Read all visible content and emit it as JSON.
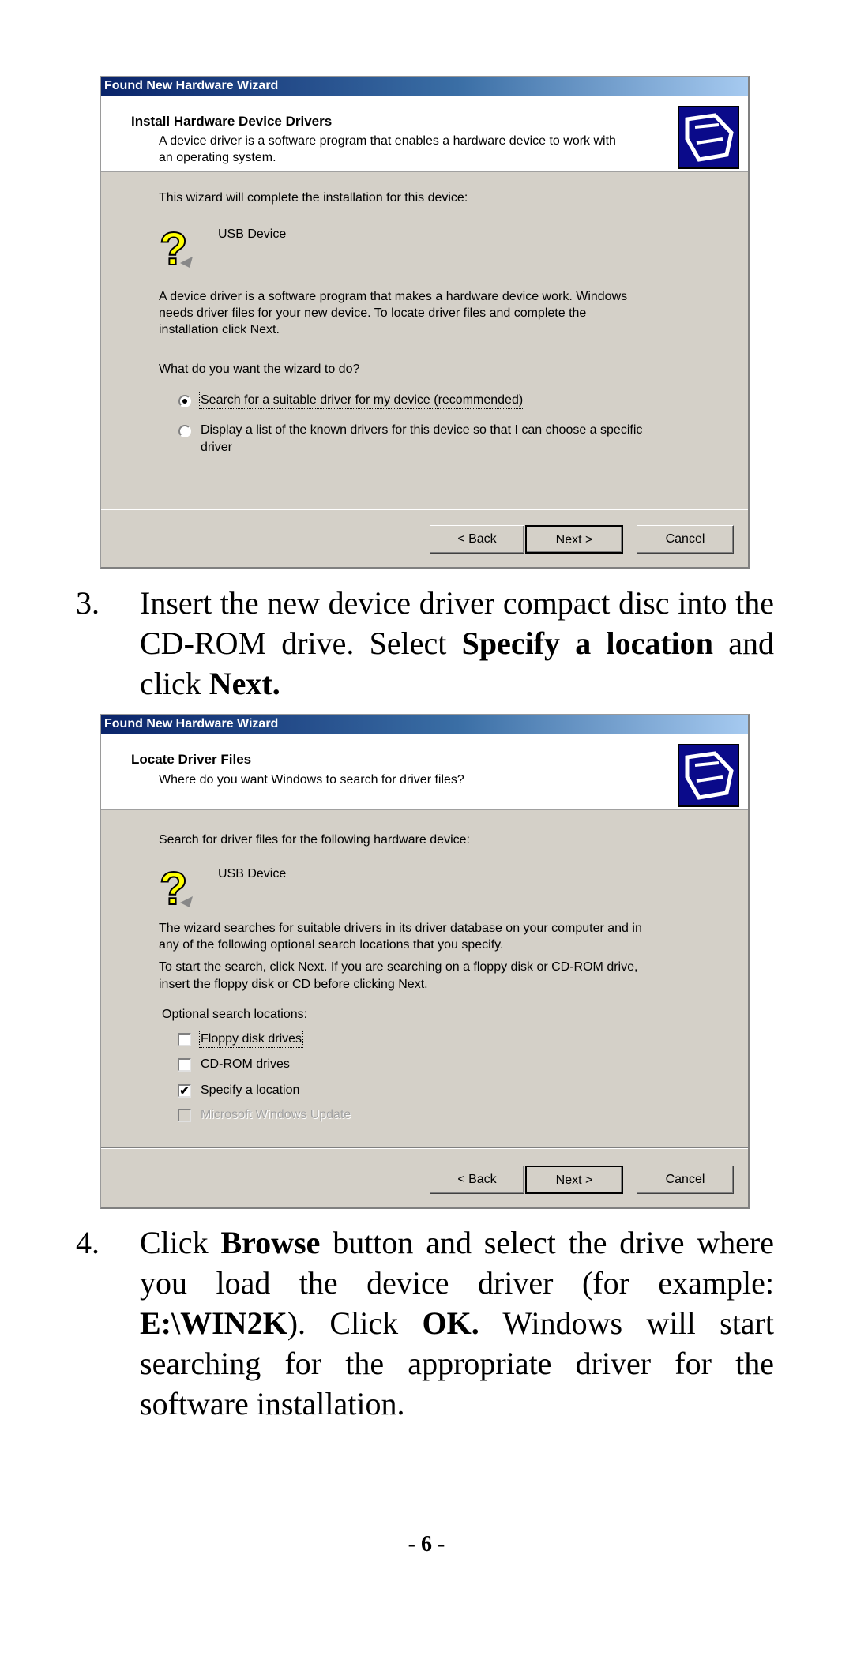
{
  "dialog1": {
    "title": "Found New Hardware Wizard",
    "header_title": "Install Hardware Device Drivers",
    "header_sub": [
      "A device driver is a software program that enables a hardware device to work with",
      "an operating system."
    ],
    "intro": "This wizard will complete the installation for this device:",
    "device": "USB Device",
    "para": [
      "A device driver is a software program that makes a hardware device work. Windows",
      "needs driver files for your new device. To locate driver files and complete the",
      "installation click Next."
    ],
    "question": "What do you want the wizard to do?",
    "option1": "Search for a suitable driver for my device (recommended)",
    "option2": [
      "Display a list of the known drivers for this device so that I can choose a specific",
      "driver"
    ],
    "selected_option": 1,
    "back": "< Back",
    "next": "Next >",
    "cancel": "Cancel"
  },
  "step3": {
    "number": "3.",
    "text_a": "Insert the new device driver compact disc into the CD-ROM drive.  Select ",
    "bold_a": "Specify a location",
    "text_b": " and click ",
    "bold_b": "Next."
  },
  "dialog2": {
    "title": "Found New Hardware Wizard",
    "header_title": "Locate Driver Files",
    "header_sub": "Where do you want Windows to search for driver files?",
    "intro": "Search for driver files for the following hardware device:",
    "device": "USB Device",
    "para1": [
      "The wizard searches for suitable drivers in its driver database on your computer and in",
      "any of the following optional search locations that you specify."
    ],
    "para2": [
      "To start the search, click Next. If you are searching on a floppy disk or CD-ROM drive,",
      "insert the floppy disk or CD before clicking Next."
    ],
    "optional_label": "Optional search locations:",
    "checkboxes": [
      {
        "label": "Floppy disk drives",
        "checked": false,
        "enabled": true
      },
      {
        "label": "CD-ROM drives",
        "checked": false,
        "enabled": true
      },
      {
        "label": "Specify a location",
        "checked": true,
        "enabled": true
      },
      {
        "label": "Microsoft Windows Update",
        "checked": false,
        "enabled": false
      }
    ],
    "back": "< Back",
    "next": "Next >",
    "cancel": "Cancel"
  },
  "step4": {
    "number": "4.",
    "t1": "Click ",
    "b1": "Browse",
    "t2": " button and select the drive where you load the device driver (for example: ",
    "b2": "E:\\WIN2K",
    "t3": ").  Click ",
    "b3": "OK.",
    "t4": " Windows will start searching for the appropriate driver for the software installation."
  },
  "page_number": "- 6 -",
  "colors": {
    "dialog_bg": "#d4d0c8",
    "titlebar_start": "#0a246a",
    "titlebar_end": "#a6caf0"
  }
}
